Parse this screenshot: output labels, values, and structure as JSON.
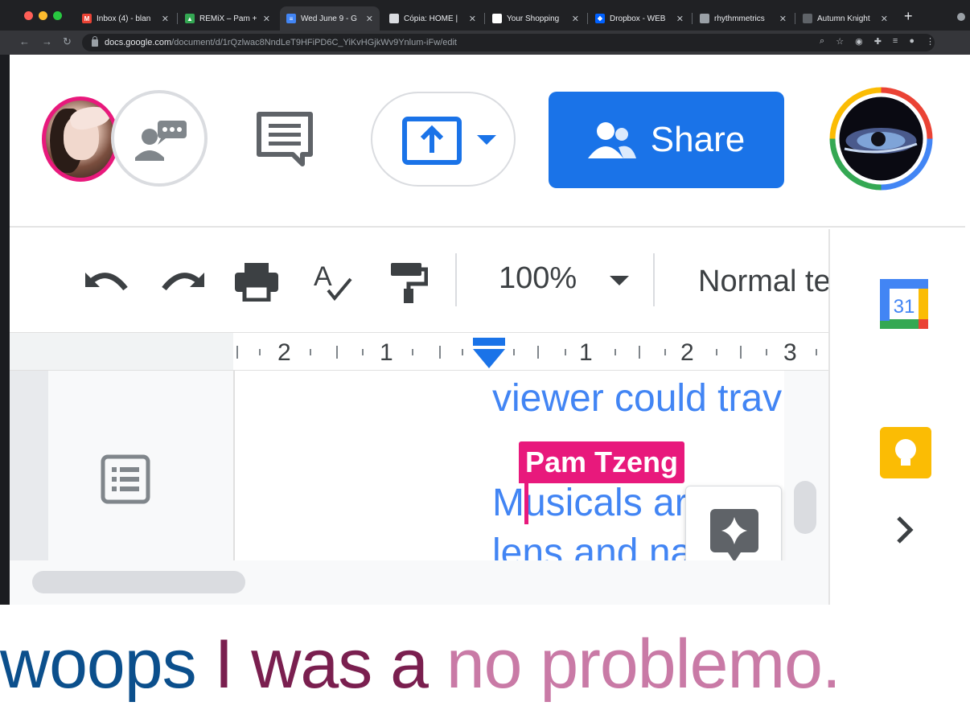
{
  "browser": {
    "tabs": [
      {
        "label": "Inbox (4) - blan",
        "icon": "gmail-icon",
        "color": "#ea4335",
        "glyph": "M"
      },
      {
        "label": "REMiX – Pam + ",
        "icon": "drive-icon",
        "color": "#34a853",
        "glyph": "▲"
      },
      {
        "label": "Wed June 9 - G",
        "icon": "docs-icon",
        "color": "#4285f4",
        "glyph": "≡"
      },
      {
        "label": "Cópia: HOME | ",
        "icon": "page-icon",
        "color": "#dadce0",
        "glyph": ""
      },
      {
        "label": "Your Shopping ",
        "icon": "shop-icon",
        "color": "#ffffff",
        "glyph": ""
      },
      {
        "label": "Dropbox - WEB ",
        "icon": "dropbox-icon",
        "color": "#0061ff",
        "glyph": "❖"
      },
      {
        "label": "rhythmmetrics ",
        "icon": "cube-icon",
        "color": "#9aa0a6",
        "glyph": ""
      },
      {
        "label": "Autumn Knight ",
        "icon": "page-icon",
        "color": "#5f6368",
        "glyph": ""
      }
    ],
    "url_host": "docs.google.com",
    "url_path": "/document/d/1rQzlwac8NndLeT9HFiPD6C_YiKvHGjkWv9Ynlum-iFw/edit"
  },
  "docs": {
    "share_label": "Share",
    "zoom": "100%",
    "style": "Normal te",
    "calendar_day": "31",
    "ruler_numbers": [
      "2",
      "1",
      "1",
      "2",
      "3"
    ],
    "body_lines": [
      "viewer could trav",
      "Musicals ar",
      "lens and na"
    ],
    "collaborator_cursor": "Pam Tzeng"
  },
  "caption": {
    "part1": "woops ",
    "part2": "I was a ",
    "part3": "no problemo.",
    "colors": {
      "part1": "#0b4f8c",
      "part2": "#7a1f4f",
      "part3": "#c97aa6"
    }
  },
  "colors": {
    "accent": "#1a73e8",
    "collaborator": "#e8197c",
    "body_text": "#4285f4"
  }
}
